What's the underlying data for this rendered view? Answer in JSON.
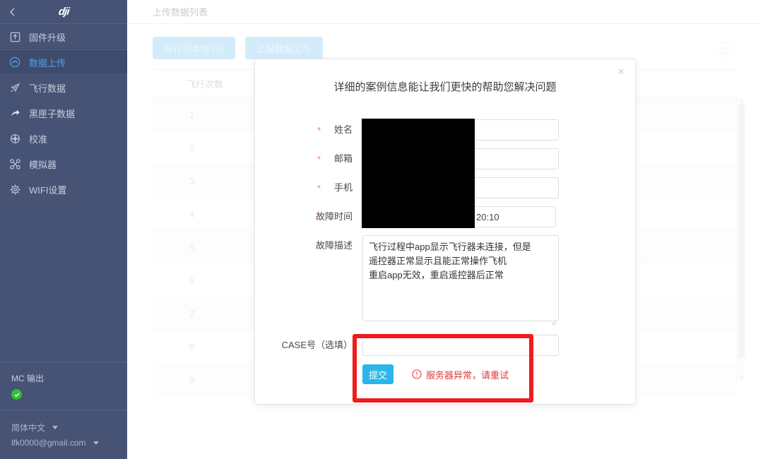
{
  "sidebar": {
    "logo_text": "dji",
    "back_icon": "chevron-left-icon",
    "items": [
      {
        "label": "固件升级",
        "icon": "firmware-upgrade-icon",
        "active": false
      },
      {
        "label": "数据上传",
        "icon": "data-upload-gauge-icon",
        "active": true
      },
      {
        "label": "飞行数据",
        "icon": "flight-data-paper-plane-icon",
        "active": false
      },
      {
        "label": "黑匣子数据",
        "icon": "black-box-arrow-icon",
        "active": false
      },
      {
        "label": "校准",
        "icon": "calibration-crosshair-icon",
        "active": false
      },
      {
        "label": "模拟器",
        "icon": "simulator-drone-icon",
        "active": false
      },
      {
        "label": "WIFI设置",
        "icon": "wifi-settings-gear-icon",
        "active": false
      }
    ],
    "mc_output": {
      "label": "MC 输出",
      "status_icon": "green-check-circle-icon",
      "status_color": "#2fbf36"
    },
    "language": {
      "label": "简体中文",
      "caret_icon": "caret-down-icon"
    },
    "account": {
      "label": "lfk0000@gmail.com",
      "caret_icon": "caret-down-icon"
    }
  },
  "main": {
    "breadcrumb": "上传数据列表",
    "camera_icon": "camera-circle-icon",
    "toolbar": {
      "save_local_label": "保存到本地 (4)",
      "upload_label": "上报数据文件"
    },
    "table": {
      "columns": [
        "飞行次数"
      ],
      "rows": [
        "1",
        "2",
        "3",
        "4",
        "5",
        "6",
        "7",
        "8",
        "9"
      ]
    },
    "scrollbar": {
      "up_icon": "scroll-up-arrow-icon",
      "down_icon": "scroll-down-arrow-icon"
    }
  },
  "modal": {
    "title": "详细的案例信息能让我们更快的帮助您解决问题",
    "close_icon": "close-icon",
    "fields": [
      {
        "label": "姓名",
        "required": true,
        "value": "",
        "type": "text"
      },
      {
        "label": "邮箱",
        "required": true,
        "value": "",
        "type": "text"
      },
      {
        "label": "手机",
        "required": true,
        "value": "",
        "type": "text"
      },
      {
        "label": "故障时间",
        "required": true,
        "value": "20:10",
        "type": "time"
      },
      {
        "label": "故障描述",
        "required": true,
        "value": "飞行过程中app显示飞行器未连接，但是\n遥控器正常显示且能正常操作飞机\n重启app无效，重启遥控器后正常",
        "type": "textarea"
      }
    ],
    "case_field": {
      "label": "CASE号（选填）",
      "required": false,
      "value": ""
    },
    "submit_label": "提交",
    "error": {
      "text": "服务器异常，请重试",
      "icon": "error-circle-icon",
      "color": "#e0393e"
    },
    "submit_color": "#29b6e8"
  },
  "annotations": {
    "redaction_box": "black-redaction-overlay",
    "highlight_box": "red-highlight-rectangle",
    "highlight_color": "#ee1c1c"
  }
}
